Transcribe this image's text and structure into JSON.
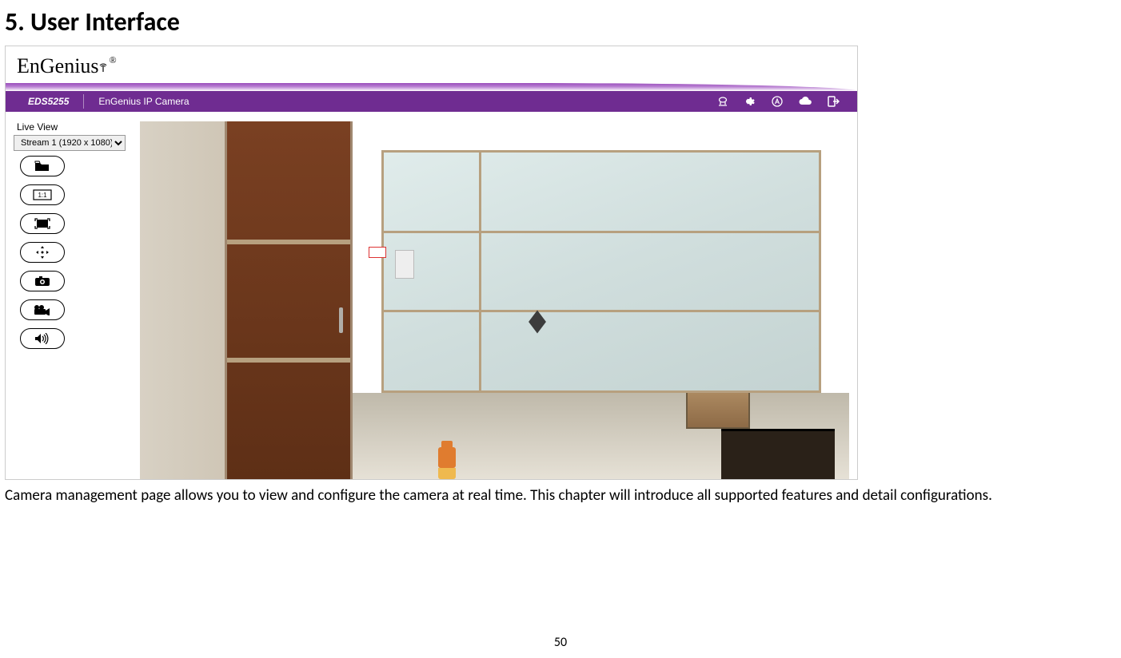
{
  "doc": {
    "heading": "5. User Interface",
    "body_text": "Camera management page allows you to view and configure the camera at real time. This chapter will introduce all supported features and detail configurations.",
    "page_number": "50"
  },
  "app": {
    "brand": "EnGenius",
    "brand_reg": "®",
    "model": "EDS5255",
    "header_title": "EnGenius IP Camera",
    "top_icons": {
      "camera": "camera-icon",
      "settings": "gear-icon",
      "auto": "auto-mode-icon",
      "cloud": "cloud-icon",
      "logout": "logout-icon"
    },
    "live_view": {
      "label": "Live View",
      "selected": "Stream 1 (1920 x 1080)"
    },
    "tools": {
      "open": "open-folder",
      "original_size": "scale-1-1",
      "fullscreen": "fullscreen",
      "ptz": "ptz-move",
      "snapshot": "snapshot",
      "record": "record",
      "audio": "audio"
    }
  }
}
